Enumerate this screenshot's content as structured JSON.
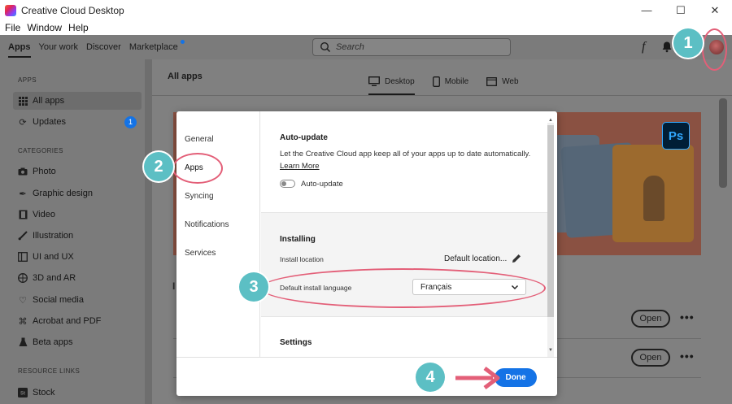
{
  "window": {
    "title": "Creative Cloud Desktop",
    "controls": [
      "—",
      "☐",
      "✕"
    ]
  },
  "menu": [
    "File",
    "Window",
    "Help"
  ],
  "topnav": {
    "tabs": [
      {
        "label": "Apps",
        "active": true
      },
      {
        "label": "Your work"
      },
      {
        "label": "Discover"
      },
      {
        "label": "Marketplace"
      }
    ],
    "search_placeholder": "Search",
    "fonts_icon": "f"
  },
  "sidebar": {
    "apps_heading": "APPS",
    "apps": [
      {
        "label": "All apps",
        "icon": "grid-icon",
        "active": true
      },
      {
        "label": "Updates",
        "icon": "refresh-icon",
        "badge": "1"
      }
    ],
    "categories_heading": "CATEGORIES",
    "categories": [
      {
        "label": "Photo",
        "icon": "camera-icon"
      },
      {
        "label": "Graphic design",
        "icon": "pen-icon"
      },
      {
        "label": "Video",
        "icon": "film-icon"
      },
      {
        "label": "Illustration",
        "icon": "brush-icon"
      },
      {
        "label": "UI and UX",
        "icon": "layout-icon"
      },
      {
        "label": "3D and AR",
        "icon": "cube-icon"
      },
      {
        "label": "Social media",
        "icon": "heart-icon"
      },
      {
        "label": "Acrobat and PDF",
        "icon": "acrobat-icon"
      },
      {
        "label": "Beta apps",
        "icon": "flask-icon"
      }
    ],
    "resources_heading": "RESOURCE LINKS",
    "resources": [
      {
        "label": "Stock",
        "icon": "stock-icon"
      }
    ]
  },
  "main": {
    "title": "All apps",
    "platform_tabs": [
      {
        "label": "Desktop",
        "active": true
      },
      {
        "label": "Mobile"
      },
      {
        "label": "Web"
      }
    ],
    "banner_app_label": "Ps",
    "section_initial": "I",
    "open_label": "Open",
    "more_label": "•••"
  },
  "dialog": {
    "nav": [
      "General",
      "Apps",
      "Syncing",
      "Notifications",
      "Services"
    ],
    "active_nav": "Apps",
    "auto_update": {
      "title": "Auto-update",
      "description": "Let the Creative Cloud app keep all of your apps up to date automatically.",
      "learn_more": "Learn More",
      "toggle_label": "Auto-update",
      "toggle_on": false
    },
    "installing": {
      "title": "Installing",
      "install_location_label": "Install location",
      "install_location_value": "Default location...",
      "default_language_label": "Default install language",
      "default_language_value": "Français"
    },
    "settings": {
      "title": "Settings"
    },
    "done_label": "Done"
  },
  "annotations": [
    "1",
    "2",
    "3",
    "4"
  ],
  "colors": {
    "accent": "#1473e6",
    "annotation": "#5cbfc4",
    "ring": "#e35f78",
    "overlay_gray": "#7b7b7b"
  }
}
